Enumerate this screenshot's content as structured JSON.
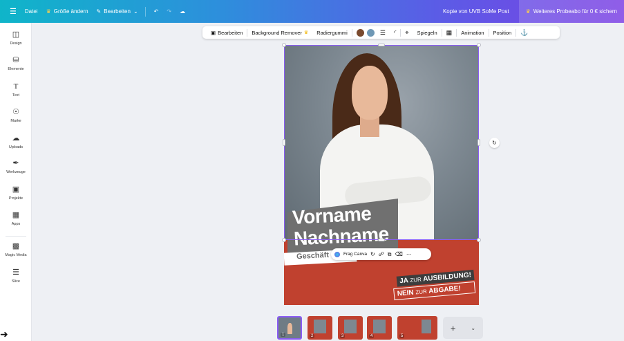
{
  "topbar": {
    "menu_icon": "hamburger-icon",
    "file": "Datei",
    "resize": "Größe ändern",
    "edit": "Bearbeiten",
    "document_title": "Kopie von UVB SoMe Post",
    "trial": "Weiteres Probeabo für 0 € sichern"
  },
  "sidebar": {
    "items": [
      {
        "label": "Design",
        "icon": "layout-icon"
      },
      {
        "label": "Elemente",
        "icon": "shapes-icon"
      },
      {
        "label": "Text",
        "icon": "text-icon"
      },
      {
        "label": "Marke",
        "icon": "brand-icon"
      },
      {
        "label": "Uploads",
        "icon": "cloud-upload-icon"
      },
      {
        "label": "Werkzeuge",
        "icon": "brush-icon"
      },
      {
        "label": "Projekte",
        "icon": "folder-icon"
      },
      {
        "label": "Apps",
        "icon": "apps-icon"
      },
      {
        "label": "Magic Media",
        "icon": "magic-media-icon"
      },
      {
        "label": "Slice",
        "icon": "slice-icon"
      }
    ]
  },
  "context_toolbar": {
    "edit": "Bearbeiten",
    "bg_remover": "Background Remover",
    "eraser": "Radiergummi",
    "color1": "#7a4a2e",
    "color2": "#6f98b5",
    "flip": "Spiegeln",
    "animation": "Animation",
    "position": "Position"
  },
  "canvas": {
    "first_name": "Vorname",
    "last_name": "Nachname",
    "subtitle": "Geschäft",
    "slogan_yes_strong": "JA",
    "slogan_yes_small": "ZUR",
    "slogan_yes_end": "AUSBILDUNG!",
    "slogan_no_strong": "NEIN",
    "slogan_no_small": "ZUR",
    "slogan_no_end": "ABGABE!",
    "accent": "#c0412f",
    "selection": "#8b5cf6"
  },
  "element_toolbar": {
    "ask_canva": "Frag Canva"
  },
  "pages": [
    "1",
    "2",
    "3",
    "4",
    "5"
  ]
}
